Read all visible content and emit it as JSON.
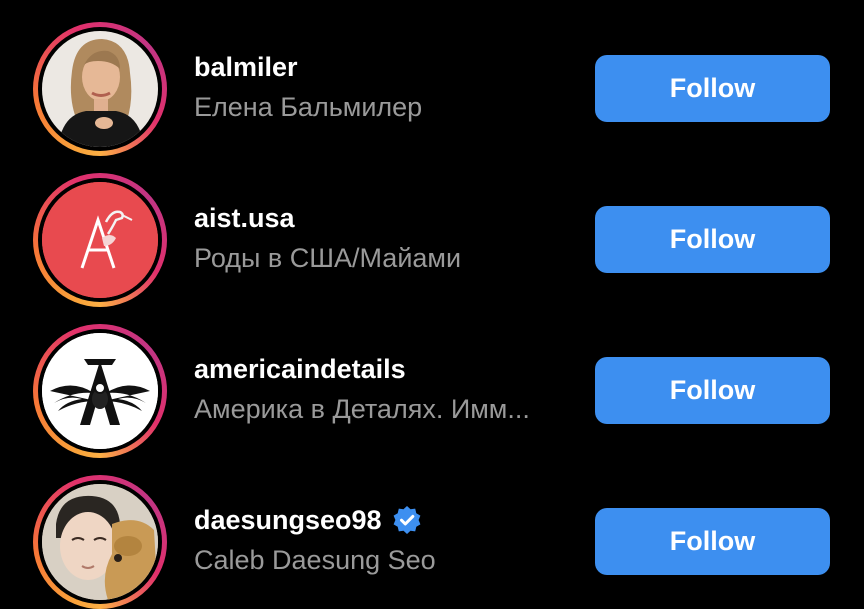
{
  "accounts": [
    {
      "username": "balmiler",
      "full_name": "Елена Бальмилер",
      "verified": false,
      "avatar": "woman-portrait",
      "follow_label": "Follow"
    },
    {
      "username": "aist.usa",
      "full_name": "Роды в США/Майами",
      "verified": false,
      "avatar": "letter-a-stork-logo",
      "avatar_bg": "#e84a4f",
      "follow_label": "Follow"
    },
    {
      "username": "americaindetails",
      "full_name": "Америка в Деталях. Имм...",
      "verified": false,
      "avatar": "eagle-letter-a-logo",
      "follow_label": "Follow"
    },
    {
      "username": "daesungseo98",
      "full_name": "Caleb Daesung Seo",
      "verified": true,
      "avatar": "man-with-dog-photo",
      "follow_label": "Follow"
    }
  ],
  "colors": {
    "background": "#000000",
    "follow_button": "#3d8ff0",
    "username": "#ffffff",
    "full_name": "#9a9a9a",
    "verified_badge": "#3d8ff0"
  }
}
